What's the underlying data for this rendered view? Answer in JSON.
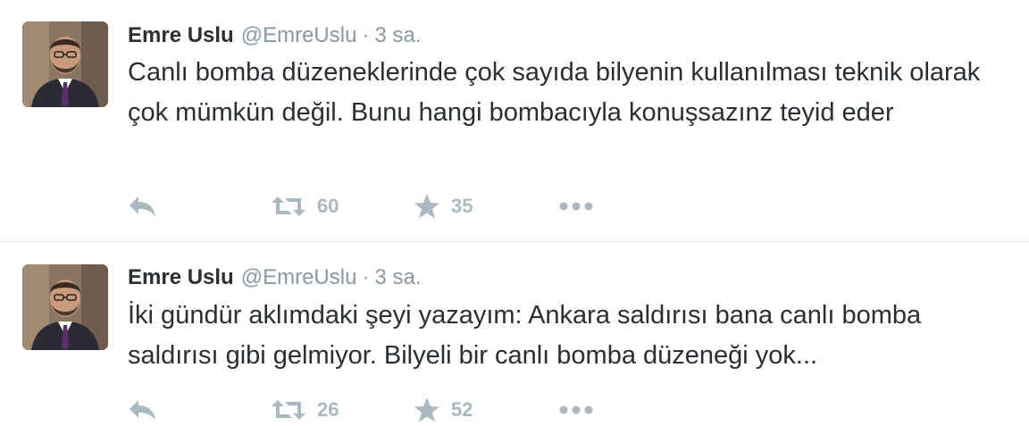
{
  "colors": {
    "name": "#292f33",
    "meta": "#8899a6",
    "action": "#aab8c2",
    "divider": "#e1e8ed"
  },
  "tweets": [
    {
      "name": "Emre Uslu",
      "handle": "@EmreUslu",
      "separator": "·",
      "time": "3 sa.",
      "text": "Canlı bomba düzeneklerinde çok sayıda bilyenin kullanılması teknik olarak çok mümkün değil. Bunu hangi bombacıyla konuşsazınz teyid eder",
      "retweets": "60",
      "favorites": "35",
      "icons": [
        "reply-icon",
        "retweet-icon",
        "star-icon",
        "more-icon"
      ]
    },
    {
      "name": "Emre Uslu",
      "handle": "@EmreUslu",
      "separator": "·",
      "time": "3 sa.",
      "text": "İki gündür aklımdaki şeyi yazayım: Ankara saldırısı bana canlı bomba saldırısı gibi gelmiyor. Bilyeli bir canlı bomba düzeneği yok...",
      "retweets": "26",
      "favorites": "52",
      "icons": [
        "reply-icon",
        "retweet-icon",
        "star-icon",
        "more-icon"
      ]
    }
  ]
}
